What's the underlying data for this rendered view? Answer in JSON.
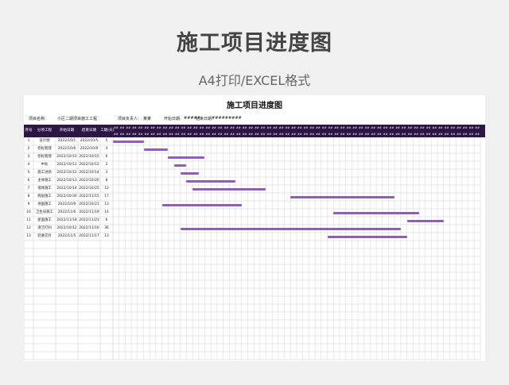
{
  "page": {
    "title": "施工项目进度图",
    "subtitle": "A4打印/EXCEL格式"
  },
  "sheet": {
    "title": "施工项目进度图",
    "project_name_label": "项目名称:",
    "project_name": "小区二期项目施工工程",
    "manager_label": "项目负责人:",
    "manager": "某某",
    "start_label": "开始日期:",
    "start_value": "#####",
    "end_label": "结束日期:",
    "end_value": "#########"
  },
  "columns": [
    "序号",
    "分项工程",
    "开始日期",
    "结束日期",
    "工期(天)"
  ],
  "day_header_text": "##",
  "day_count": 60,
  "header_color": "#2d1646",
  "bar_color": "#9a52d6",
  "tasks": [
    {
      "no": "1",
      "name": "设计图",
      "start": "2022/10/1",
      "end": "2022/10/5",
      "days": "5",
      "offset": 0,
      "duration": 5
    },
    {
      "no": "2",
      "name": "招标管理",
      "start": "2022/10/6",
      "end": "2022/10/9",
      "days": "4",
      "offset": 5,
      "duration": 4
    },
    {
      "no": "3",
      "name": "招标管理",
      "start": "2022/10/10",
      "end": "2022/10/15",
      "days": "6",
      "offset": 9,
      "duration": 6
    },
    {
      "no": "4",
      "name": "中标",
      "start": "2022/10/11",
      "end": "2022/10/12",
      "days": "2",
      "offset": 10,
      "duration": 2
    },
    {
      "no": "5",
      "name": "施工进场",
      "start": "2022/10/12",
      "end": "2022/10/14",
      "days": "3",
      "offset": 11,
      "duration": 3
    },
    {
      "no": "6",
      "name": "主体施工",
      "start": "2022/10/13",
      "end": "2022/10/20",
      "days": "8",
      "offset": 12,
      "duration": 8
    },
    {
      "no": "7",
      "name": "墙体施工",
      "start": "2022/10/14",
      "end": "2022/10/25",
      "days": "12",
      "offset": 13,
      "duration": 12
    },
    {
      "no": "8",
      "name": "两层施工",
      "start": "2022/10/30",
      "end": "2022/11/15",
      "days": "17",
      "offset": 29,
      "duration": 17
    },
    {
      "no": "9",
      "name": "地面施工",
      "start": "2022/10/9",
      "end": "2022/10/21",
      "days": "13",
      "offset": 8,
      "duration": 13
    },
    {
      "no": "10",
      "name": "卫生间施工",
      "start": "2022/11/6",
      "end": "2022/11/19",
      "days": "14",
      "offset": 36,
      "duration": 14
    },
    {
      "no": "11",
      "name": "屋面施工",
      "start": "2022/11/18",
      "end": "2022/11/23",
      "days": "6",
      "offset": 48,
      "duration": 6
    },
    {
      "no": "12",
      "name": "清洁打扫",
      "start": "2022/10/12",
      "end": "2022/11/16",
      "days": "36",
      "offset": 11,
      "duration": 36
    },
    {
      "no": "13",
      "name": "验收交付",
      "start": "2022/11/5",
      "end": "2022/11/17",
      "days": "13",
      "offset": 35,
      "duration": 13
    }
  ]
}
